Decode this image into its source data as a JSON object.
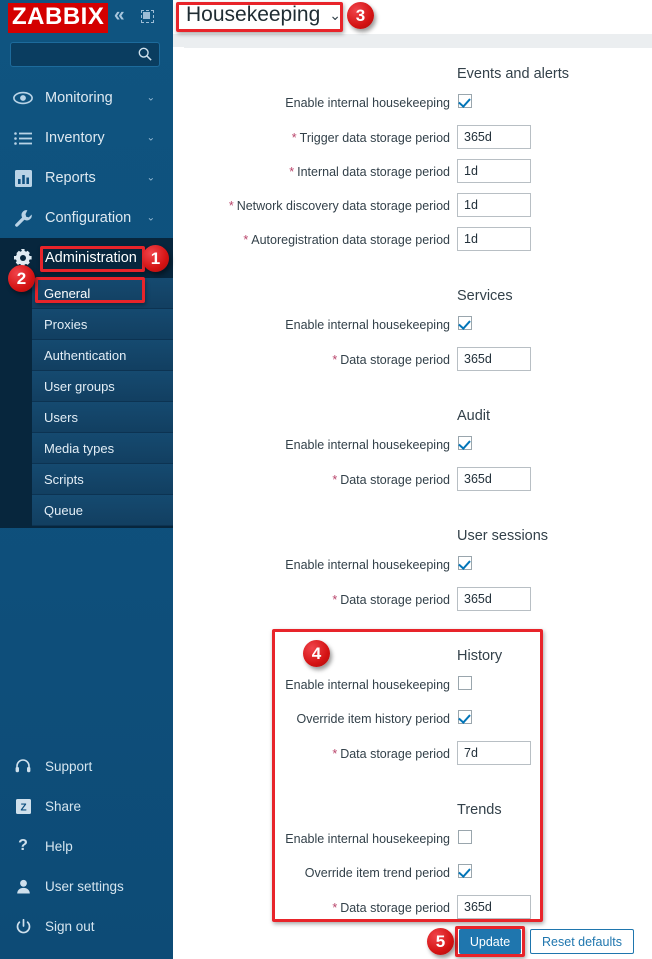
{
  "brand": {
    "logo": "ZABBIX",
    "accent": "#d40000",
    "sidebar_bg": "#0e5080"
  },
  "sidebar": {
    "collapse_icon": "«",
    "search": {
      "value": "",
      "placeholder": ""
    },
    "nav": [
      {
        "label": "Monitoring",
        "icon": "eye-icon",
        "chevron": "⌄",
        "active": false
      },
      {
        "label": "Inventory",
        "icon": "list-icon",
        "chevron": "⌄",
        "active": false
      },
      {
        "label": "Reports",
        "icon": "bar-chart-icon",
        "chevron": "⌄",
        "active": false
      },
      {
        "label": "Configuration",
        "icon": "wrench-icon",
        "chevron": "⌄",
        "active": false
      },
      {
        "label": "Administration",
        "icon": "gear-icon",
        "chevron": "",
        "active": true
      }
    ],
    "subnav": [
      {
        "label": "General",
        "selected": true
      },
      {
        "label": "Proxies",
        "selected": false
      },
      {
        "label": "Authentication",
        "selected": false
      },
      {
        "label": "User groups",
        "selected": false
      },
      {
        "label": "Users",
        "selected": false
      },
      {
        "label": "Media types",
        "selected": false
      },
      {
        "label": "Scripts",
        "selected": false
      },
      {
        "label": "Queue",
        "selected": false
      }
    ],
    "bottom": [
      {
        "label": "Support",
        "icon": "headset-icon"
      },
      {
        "label": "Share",
        "icon": "zabbix-share-icon"
      },
      {
        "label": "Help",
        "icon": "question-icon"
      },
      {
        "label": "User settings",
        "icon": "person-icon"
      },
      {
        "label": "Sign out",
        "icon": "power-icon"
      }
    ]
  },
  "header": {
    "page_title": "Housekeeping",
    "caret": "⌄"
  },
  "form": {
    "sections": [
      {
        "title": "Events and alerts",
        "rows": [
          {
            "type": "checkbox",
            "label": "Enable internal housekeeping",
            "required": false,
            "checked": true
          },
          {
            "type": "text",
            "label": "Trigger data storage period",
            "required": true,
            "value": "365d"
          },
          {
            "type": "text",
            "label": "Internal data storage period",
            "required": true,
            "value": "1d"
          },
          {
            "type": "text",
            "label": "Network discovery data storage period",
            "required": true,
            "value": "1d"
          },
          {
            "type": "text",
            "label": "Autoregistration data storage period",
            "required": true,
            "value": "1d"
          }
        ]
      },
      {
        "title": "Services",
        "rows": [
          {
            "type": "checkbox",
            "label": "Enable internal housekeeping",
            "required": false,
            "checked": true
          },
          {
            "type": "text",
            "label": "Data storage period",
            "required": true,
            "value": "365d"
          }
        ]
      },
      {
        "title": "Audit",
        "rows": [
          {
            "type": "checkbox",
            "label": "Enable internal housekeeping",
            "required": false,
            "checked": true
          },
          {
            "type": "text",
            "label": "Data storage period",
            "required": true,
            "value": "365d"
          }
        ]
      },
      {
        "title": "User sessions",
        "rows": [
          {
            "type": "checkbox",
            "label": "Enable internal housekeeping",
            "required": false,
            "checked": true
          },
          {
            "type": "text",
            "label": "Data storage period",
            "required": true,
            "value": "365d"
          }
        ]
      },
      {
        "title": "History",
        "rows": [
          {
            "type": "checkbox",
            "label": "Enable internal housekeeping",
            "required": false,
            "checked": false
          },
          {
            "type": "checkbox",
            "label": "Override item history period",
            "required": false,
            "checked": true
          },
          {
            "type": "text",
            "label": "Data storage period",
            "required": true,
            "value": "7d"
          }
        ]
      },
      {
        "title": "Trends",
        "rows": [
          {
            "type": "checkbox",
            "label": "Enable internal housekeeping",
            "required": false,
            "checked": false
          },
          {
            "type": "checkbox",
            "label": "Override item trend period",
            "required": false,
            "checked": true
          },
          {
            "type": "text",
            "label": "Data storage period",
            "required": true,
            "value": "365d"
          }
        ]
      }
    ],
    "buttons": {
      "update": "Update",
      "reset": "Reset defaults"
    }
  },
  "annotations": {
    "color": "#e8242a",
    "markers": [
      {
        "n": "1",
        "target": "administration-menu"
      },
      {
        "n": "2",
        "target": "general-submenu"
      },
      {
        "n": "3",
        "target": "housekeeping-title"
      },
      {
        "n": "4",
        "target": "history-trends-block"
      },
      {
        "n": "5",
        "target": "update-button"
      }
    ]
  }
}
